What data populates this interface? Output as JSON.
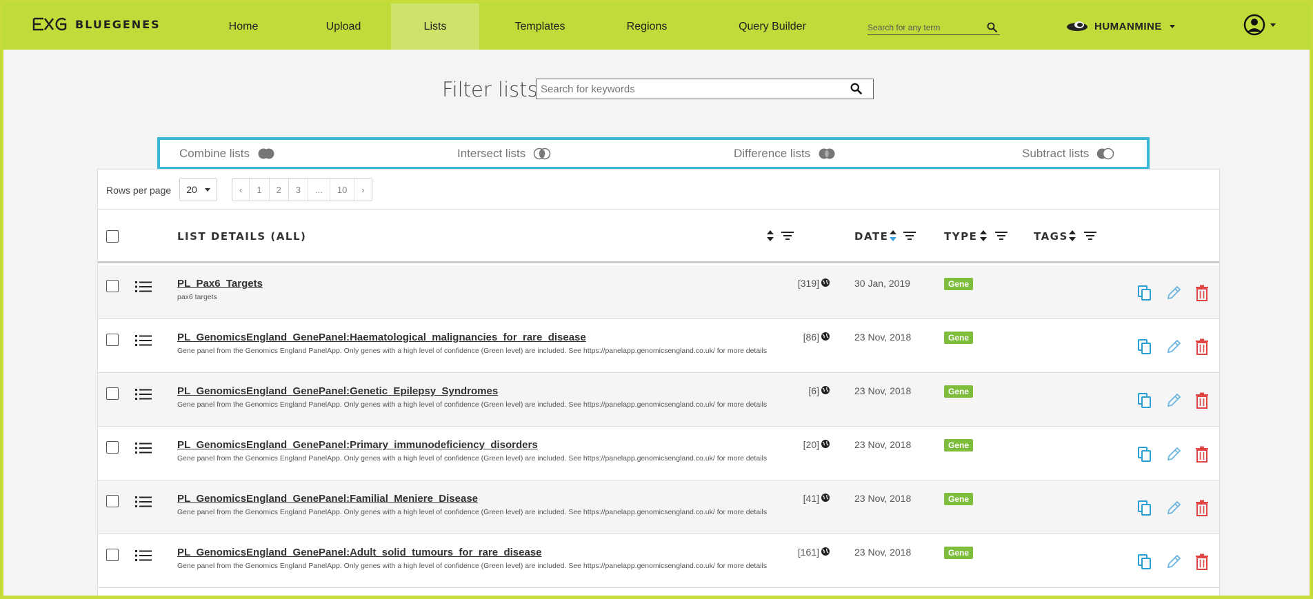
{
  "app": {
    "logo_text": "BLUEGENES"
  },
  "nav": {
    "items": [
      {
        "label": "Home"
      },
      {
        "label": "Upload"
      },
      {
        "label": "Lists",
        "active": true
      },
      {
        "label": "Templates"
      },
      {
        "label": "Regions"
      },
      {
        "label": "Query Builder"
      }
    ],
    "search_placeholder": "Search for any term",
    "mine_name": "HUMANMINE"
  },
  "filter": {
    "title": "Filter lists",
    "placeholder": "Search for keywords"
  },
  "operations": [
    {
      "label": "Combine lists"
    },
    {
      "label": "Intersect lists"
    },
    {
      "label": "Difference lists"
    },
    {
      "label": "Subtract lists"
    }
  ],
  "pagination": {
    "rows_label": "Rows per page",
    "rows_value": "20",
    "pages": [
      "‹",
      "1",
      "2",
      "3",
      "...",
      "10",
      "›"
    ]
  },
  "table": {
    "headers": {
      "details": "LIST DETAILS (ALL)",
      "date": "DATE",
      "type": "TYPE",
      "tags": "TAGS"
    },
    "rows": [
      {
        "name": "PL_Pax6_Targets",
        "desc": "pax6 targets",
        "count": "[319]",
        "date": "30 Jan, 2019",
        "type": "Gene"
      },
      {
        "name": "PL_GenomicsEngland_GenePanel:Haematological_malignancies_for_rare_disease",
        "desc": "Gene panel from the Genomics England PanelApp. Only genes with a high level of confidence (Green level) are included. See https://panelapp.genomicsengland.co.uk/ for more details",
        "count": "[86]",
        "date": "23 Nov, 2018",
        "type": "Gene"
      },
      {
        "name": "PL_GenomicsEngland_GenePanel:Genetic_Epilepsy_Syndromes",
        "desc": "Gene panel from the Genomics England PanelApp. Only genes with a high level of confidence (Green level) are included. See https://panelapp.genomicsengland.co.uk/ for more details",
        "count": "[6]",
        "date": "23 Nov, 2018",
        "type": "Gene"
      },
      {
        "name": "PL_GenomicsEngland_GenePanel:Primary_immunodeficiency_disorders",
        "desc": "Gene panel from the Genomics England PanelApp. Only genes with a high level of confidence (Green level) are included. See https://panelapp.genomicsengland.co.uk/ for more details",
        "count": "[20]",
        "date": "23 Nov, 2018",
        "type": "Gene"
      },
      {
        "name": "PL_GenomicsEngland_GenePanel:Familial_Meniere_Disease",
        "desc": "Gene panel from the Genomics England PanelApp. Only genes with a high level of confidence (Green level) are included. See https://panelapp.genomicsengland.co.uk/ for more details",
        "count": "[41]",
        "date": "23 Nov, 2018",
        "type": "Gene"
      },
      {
        "name": "PL_GenomicsEngland_GenePanel:Adult_solid_tumours_for_rare_disease",
        "desc": "Gene panel from the Genomics England PanelApp. Only genes with a high level of confidence (Green level) are included. See https://panelapp.genomicsengland.co.uk/ for more details",
        "count": "[161]",
        "date": "23 Nov, 2018",
        "type": "Gene"
      }
    ]
  },
  "colors": {
    "brand": "#c0dc3a",
    "highlight": "#3cb6d6",
    "badge": "#7fbd3c",
    "action_blue": "#2a9fd6",
    "action_red": "#e04545"
  }
}
